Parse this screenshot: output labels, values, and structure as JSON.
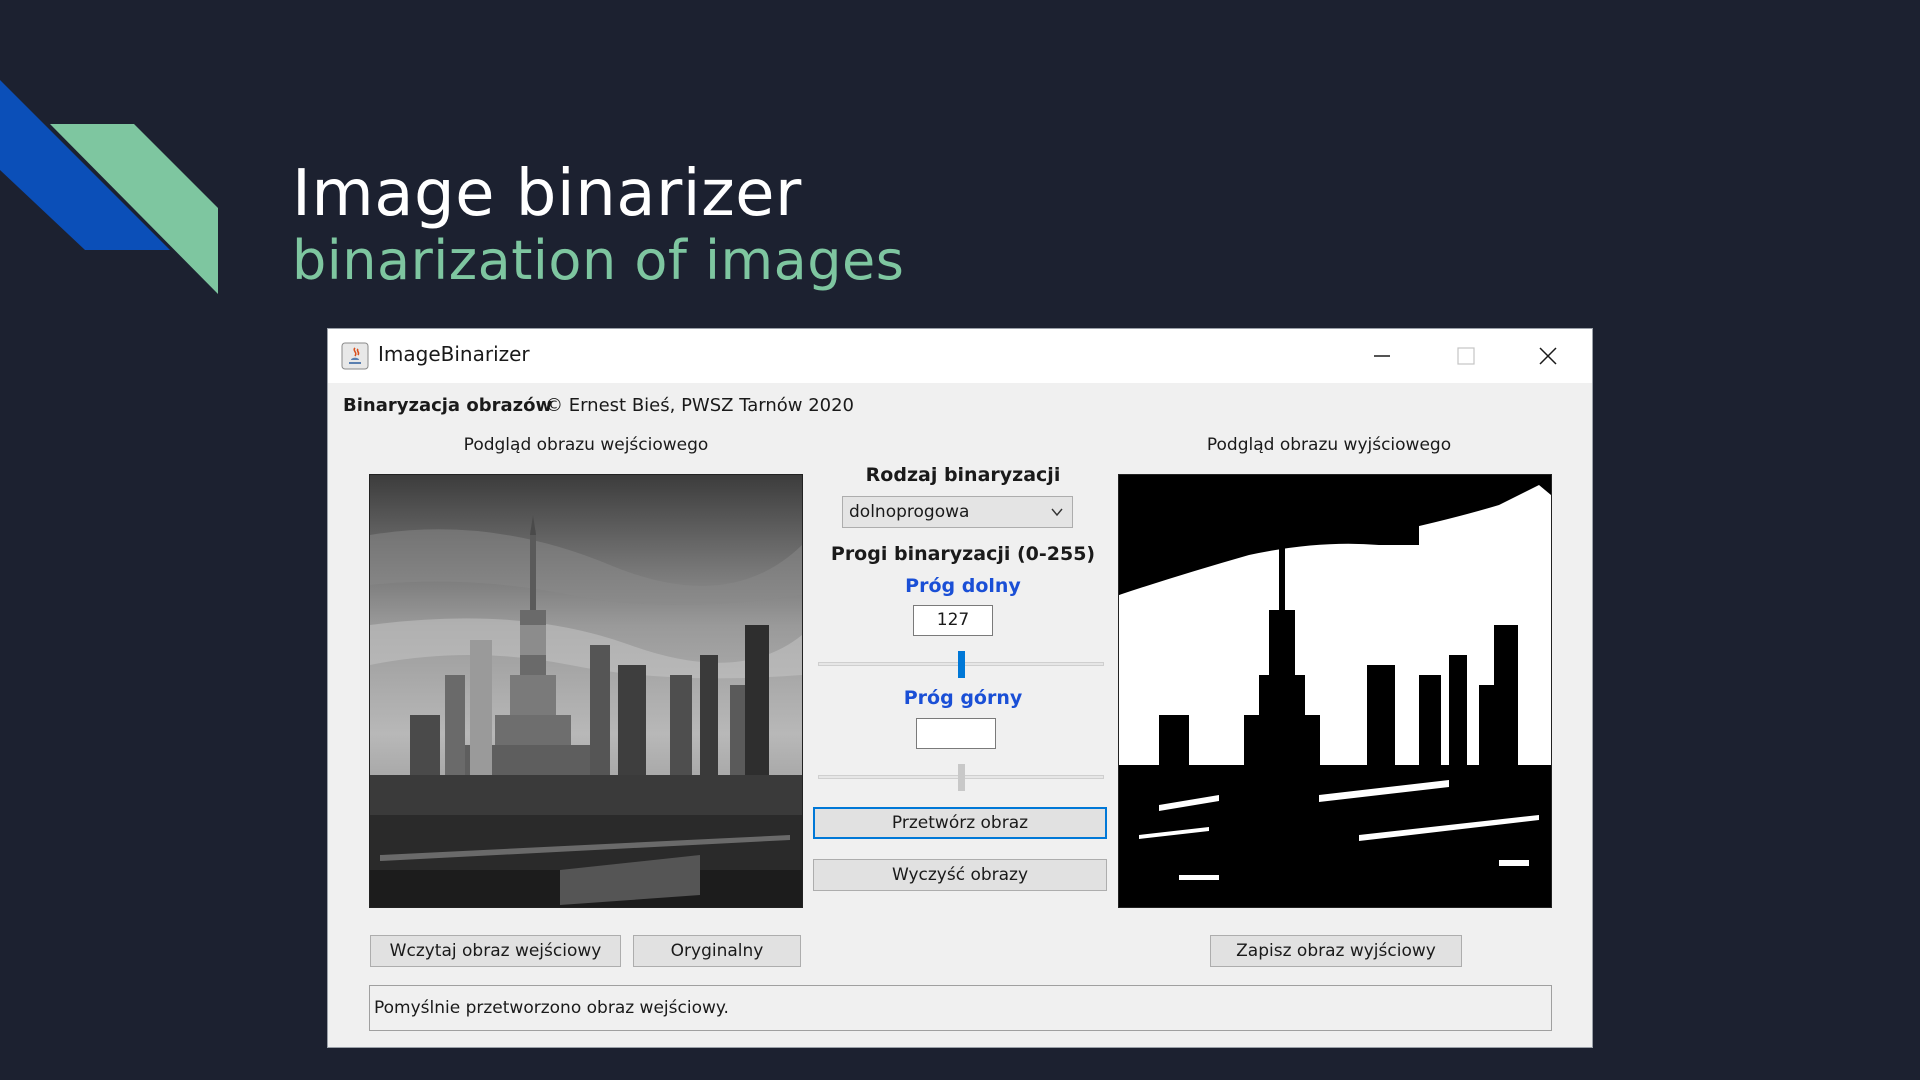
{
  "slide": {
    "title": "Image binarizer",
    "subtitle": "binarization of images"
  },
  "window": {
    "title": "ImageBinarizer",
    "controls": [
      "minimize-icon",
      "maximize-icon",
      "close-icon"
    ]
  },
  "header": {
    "app_name": "Binaryzacja obrazów",
    "credit": "© Ernest Bieś, PWSZ Tarnów 2020"
  },
  "input_panel": {
    "caption": "Podgląd obrazu wejściowego",
    "load_button": "Wczytaj obraz wejściowy",
    "original_button": "Oryginalny"
  },
  "output_panel": {
    "caption": "Podgląd obrazu wyjściowego",
    "save_button": "Zapisz obraz wyjściowy"
  },
  "controls": {
    "binarization_type_label": "Rodzaj binaryzacji",
    "binarization_type_value": "dolnoprogowa",
    "thresholds_label": "Progi binaryzacji (0-255)",
    "lower_label": "Próg dolny",
    "lower_value": "127",
    "lower_slider_fraction": 0.5,
    "upper_label": "Próg górny",
    "upper_value": "",
    "upper_slider_fraction": 0.5,
    "process_button": "Przetwórz obraz",
    "clear_button": "Wyczyść obrazy"
  },
  "status": {
    "message": "Pomyślnie przetworzono obraz wejściowy."
  },
  "colors": {
    "background": "#1c2130",
    "accent_green": "#7ec6a0",
    "accent_blue": "#0b4fb8",
    "label_blue": "#1a4fd6",
    "slider_active": "#0078d7"
  }
}
